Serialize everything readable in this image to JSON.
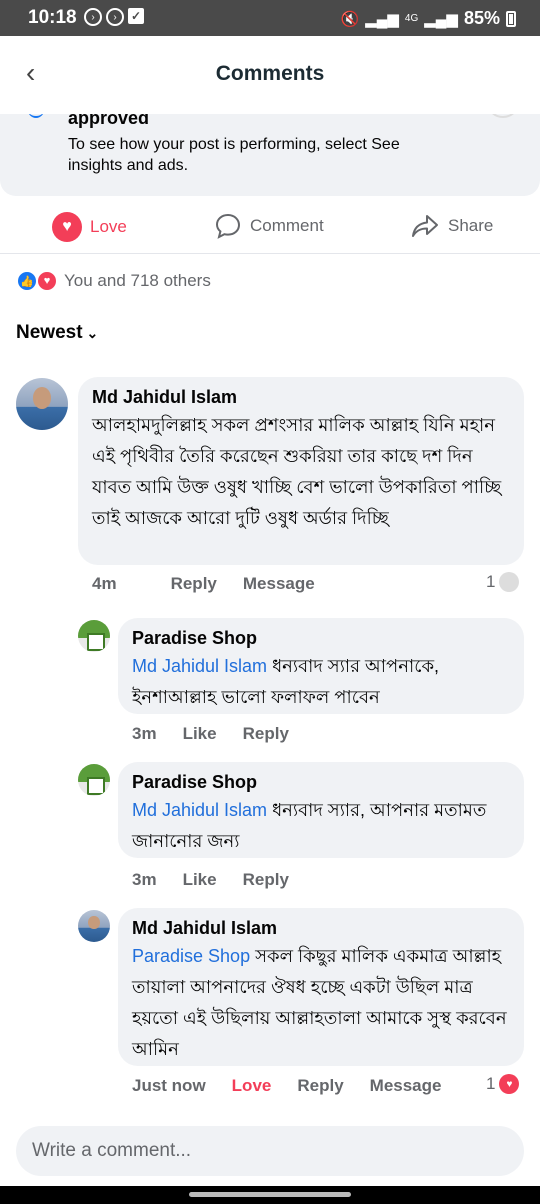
{
  "status_bar": {
    "time": "10:18",
    "network": "4G",
    "battery": "85%"
  },
  "header": {
    "back_icon": "chevron-left-icon",
    "title": "Comments"
  },
  "post": {
    "approved_text": "approved",
    "insight_text": "To see how your post is performing, select See insights and ads."
  },
  "actions": {
    "love_label": "Love",
    "comment_label": "Comment",
    "share_label": "Share"
  },
  "reactions": {
    "summary": "You and 718 others"
  },
  "sort": {
    "label": "Newest"
  },
  "comments": [
    {
      "author": "Md Jahidul Islam",
      "text": "আলহামদুলিল্লাহ সকল প্রশংসার মালিক আল্লাহ যিনি মহান এই পৃথিবীর তৈরি করেছেন শুকরিয়া তার কাছে দশ দিন যাবত আমি উক্ত ওষুধ খাচ্ছি বেশ ভালো উপকারিতা পাচ্ছি তাই আজকে আরো দুটি ওষুধ অর্ডার দিচ্ছি",
      "time": "4m",
      "reply_label": "Reply",
      "message_label": "Message",
      "reaction_count": "1"
    }
  ],
  "replies": [
    {
      "author": "Paradise Shop",
      "mention": "Md Jahidul Islam",
      "text": " ধন্যবাদ স্যার আপনাকে, ইনশাআল্লাহ ভালো ফলাফল পাবেন",
      "time": "3m",
      "like_label": "Like",
      "reply_label": "Reply"
    },
    {
      "author": "Paradise Shop",
      "mention": "Md Jahidul Islam",
      "text": " ধন্যবাদ স্যার, আপনার মতামত জানানোর জন্য",
      "time": "3m",
      "like_label": "Like",
      "reply_label": "Reply"
    },
    {
      "author": "Md Jahidul Islam",
      "mention": "Paradise Shop",
      "text": " সকল কিছুর মালিক একমাত্র আল্লাহ তায়ালা আপনাদের ঔষধ হচ্ছে একটা উছিল মাত্র হয়তো এই উছিলায় আল্লাহতালা আমাকে সুস্থ করবেন আমিন",
      "time": "Just now",
      "love_label": "Love",
      "reply_label": "Reply",
      "message_label": "Message",
      "reaction_count": "1"
    }
  ],
  "composer": {
    "placeholder": "Write a comment..."
  },
  "colors": {
    "accent_blue": "#216fdb",
    "love_red": "#f33e58",
    "bubble_bg": "#f0f2f5"
  }
}
